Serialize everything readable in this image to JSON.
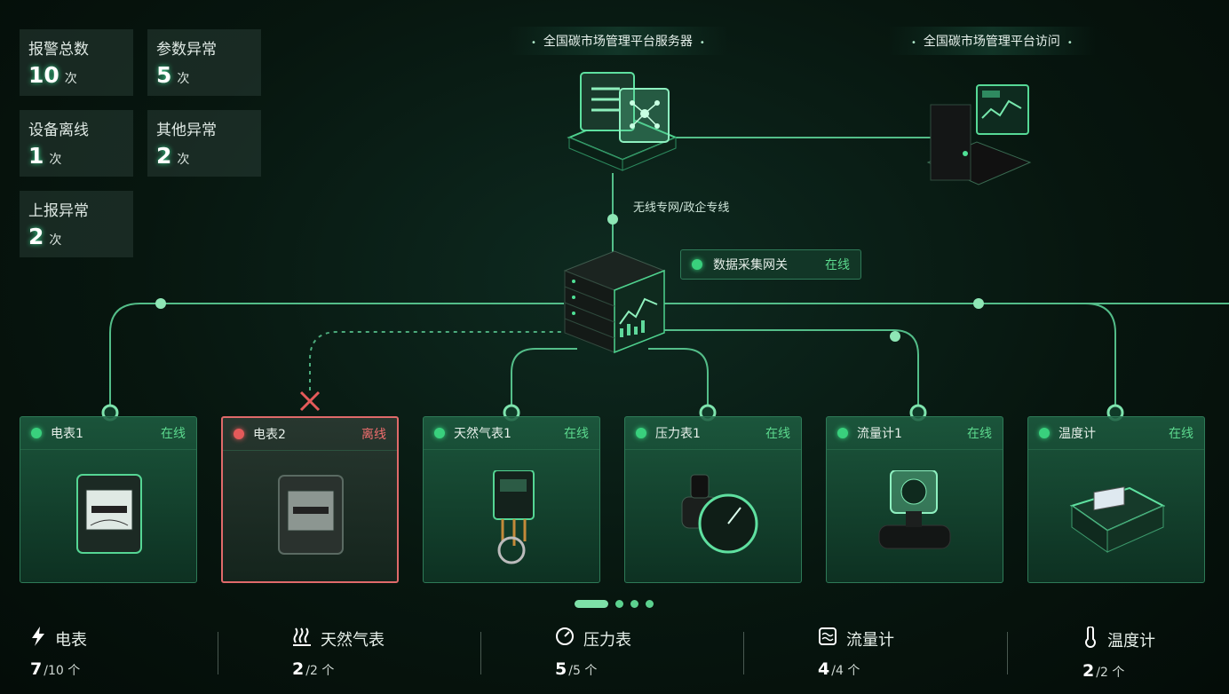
{
  "stats": [
    {
      "label": "报警总数",
      "value": "10",
      "unit": "次"
    },
    {
      "label": "参数异常",
      "value": "5",
      "unit": "次"
    },
    {
      "label": "设备离线",
      "value": "1",
      "unit": "次"
    },
    {
      "label": "其他异常",
      "value": "2",
      "unit": "次"
    },
    {
      "label": "上报异常",
      "value": "2",
      "unit": "次"
    }
  ],
  "server": {
    "label": "全国碳市场管理平台服务器"
  },
  "access": {
    "label": "全国碳市场管理平台访问"
  },
  "link": {
    "label": "无线专网/政企专线"
  },
  "gateway": {
    "name": "数据采集网关",
    "status": "在线"
  },
  "devices": [
    {
      "name": "电表1",
      "status": "在线",
      "online": true,
      "icon": "meter-icon"
    },
    {
      "name": "电表2",
      "status": "离线",
      "online": false,
      "icon": "meter-icon"
    },
    {
      "name": "天然气表1",
      "status": "在线",
      "online": true,
      "icon": "gas-meter-icon"
    },
    {
      "name": "压力表1",
      "status": "在线",
      "online": true,
      "icon": "pressure-gauge-icon"
    },
    {
      "name": "流量计1",
      "status": "在线",
      "online": true,
      "icon": "flow-meter-icon"
    },
    {
      "name": "温度计",
      "status": "在线",
      "online": true,
      "icon": "thermometer-device-icon"
    }
  ],
  "summary": [
    {
      "label": "电表",
      "count": "7",
      "total": "/10",
      "unit": "个",
      "icon": "lightning-icon"
    },
    {
      "label": "天然气表",
      "count": "2",
      "total": "/2",
      "unit": "个",
      "icon": "heat-waves-icon"
    },
    {
      "label": "压力表",
      "count": "5",
      "total": "/5",
      "unit": "个",
      "icon": "gauge-icon"
    },
    {
      "label": "流量计",
      "count": "4",
      "total": "/4",
      "unit": "个",
      "icon": "flow-icon"
    },
    {
      "label": "温度计",
      "count": "2",
      "total": "/2",
      "unit": "个",
      "icon": "thermometer-icon"
    }
  ]
}
